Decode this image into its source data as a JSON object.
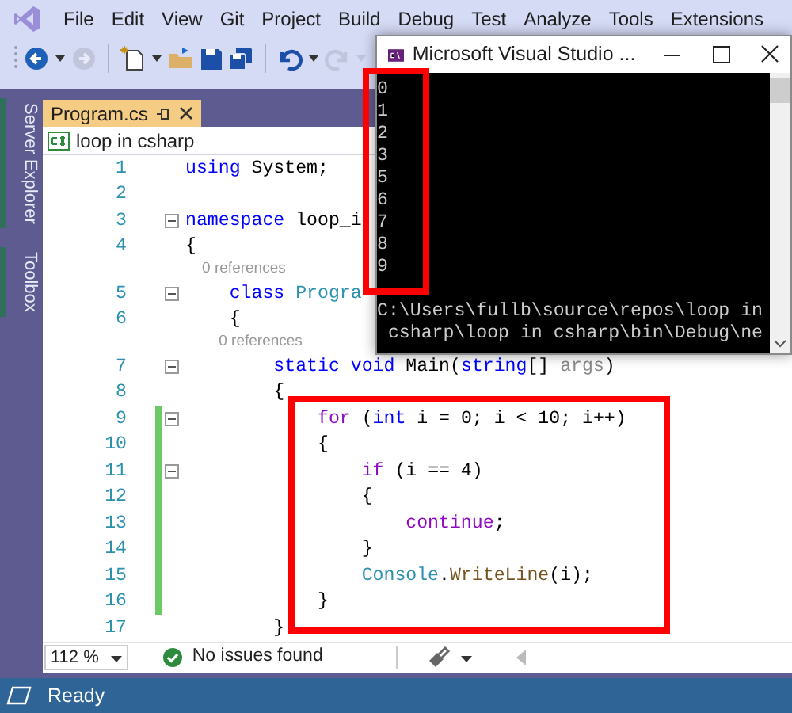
{
  "menu_items": [
    "File",
    "Edit",
    "View",
    "Git",
    "Project",
    "Build",
    "Debug",
    "Test",
    "Analyze",
    "Tools",
    "Extensions"
  ],
  "toolbar": [
    {
      "kind": "back",
      "disabled": false
    },
    {
      "kind": "dropdown",
      "disabled": false
    },
    {
      "kind": "forward",
      "disabled": true
    },
    {
      "kind": "separator"
    },
    {
      "kind": "new-item",
      "disabled": false
    },
    {
      "kind": "dropdown",
      "disabled": false
    },
    {
      "kind": "open",
      "disabled": false
    },
    {
      "kind": "save",
      "disabled": false
    },
    {
      "kind": "save-all",
      "disabled": false
    },
    {
      "kind": "separator"
    },
    {
      "kind": "undo",
      "disabled": false
    },
    {
      "kind": "dropdown",
      "disabled": false
    },
    {
      "kind": "redo",
      "disabled": true
    },
    {
      "kind": "dropdown",
      "disabled": true
    }
  ],
  "side_tabs": [
    {
      "label": "Server Explorer"
    },
    {
      "label": "Toolbox"
    }
  ],
  "document_tabs": [
    {
      "label": "Program.cs",
      "selected": true
    }
  ],
  "navigation_bar": {
    "project": "loop in csharp"
  },
  "code_lines": [
    {
      "kind": "code",
      "number": "1",
      "changed": false,
      "fold": false,
      "tokens": [
        {
          "text": "using",
          "kind": "keyword"
        },
        {
          "text": " System;",
          "kind": "plain"
        }
      ]
    },
    {
      "kind": "code",
      "number": "2",
      "changed": false,
      "fold": false
    },
    {
      "kind": "code",
      "number": "3",
      "changed": false,
      "fold": true,
      "tokens": [
        {
          "text": "namespace",
          "kind": "keyword"
        },
        {
          "text": " loop_i",
          "kind": "plain"
        }
      ]
    },
    {
      "kind": "code",
      "number": "4",
      "changed": false,
      "fold": false,
      "tokens": [
        {
          "text": "{",
          "kind": "plain"
        }
      ]
    },
    {
      "kind": "refs",
      "tokens": [
        {
          "text": "    0 references",
          "kind": "refs"
        }
      ]
    },
    {
      "kind": "code",
      "number": "5",
      "changed": false,
      "fold": true,
      "tokens": [
        {
          "text": "    class",
          "kind": "keyword"
        },
        {
          "text": " Progra",
          "kind": "type"
        }
      ]
    },
    {
      "kind": "code",
      "number": "6",
      "changed": false,
      "fold": false,
      "tokens": [
        {
          "text": "    {",
          "kind": "plain"
        }
      ]
    },
    {
      "kind": "refs",
      "tokens": [
        {
          "text": "        0 references",
          "kind": "refs"
        }
      ]
    },
    {
      "kind": "code",
      "number": "7",
      "changed": false,
      "fold": true,
      "tokens": [
        {
          "text": "        static",
          "kind": "keyword"
        },
        {
          "text": " void",
          "kind": "keyword"
        },
        {
          "text": " Main(",
          "kind": "plain"
        },
        {
          "text": "string",
          "kind": "keyword"
        },
        {
          "text": "[] ",
          "kind": "plain"
        },
        {
          "text": "args",
          "kind": "unused"
        },
        {
          "text": ")",
          "kind": "plain"
        }
      ]
    },
    {
      "kind": "code",
      "number": "8",
      "changed": false,
      "fold": false,
      "tokens": [
        {
          "text": "        {",
          "kind": "plain"
        }
      ]
    },
    {
      "kind": "code",
      "number": "9",
      "changed": true,
      "fold": true,
      "tokens": [
        {
          "text": "            for",
          "kind": "control"
        },
        {
          "text": " (",
          "kind": "plain"
        },
        {
          "text": "int",
          "kind": "keyword"
        },
        {
          "text": " i = 0; i < 10; i++)",
          "kind": "plain"
        }
      ]
    },
    {
      "kind": "code",
      "number": "10",
      "changed": true,
      "fold": false,
      "tokens": [
        {
          "text": "            {",
          "kind": "plain"
        }
      ]
    },
    {
      "kind": "code",
      "number": "11",
      "changed": true,
      "fold": true,
      "tokens": [
        {
          "text": "                if",
          "kind": "control"
        },
        {
          "text": " (i == 4)",
          "kind": "plain"
        }
      ]
    },
    {
      "kind": "code",
      "number": "12",
      "changed": true,
      "fold": false,
      "tokens": [
        {
          "text": "                {",
          "kind": "plain"
        }
      ]
    },
    {
      "kind": "code",
      "number": "13",
      "changed": true,
      "fold": false,
      "tokens": [
        {
          "text": "                    continue",
          "kind": "control"
        },
        {
          "text": ";",
          "kind": "plain"
        }
      ]
    },
    {
      "kind": "code",
      "number": "14",
      "changed": true,
      "fold": false,
      "tokens": [
        {
          "text": "                }",
          "kind": "plain"
        }
      ]
    },
    {
      "kind": "code",
      "number": "15",
      "changed": true,
      "fold": false,
      "tokens": [
        {
          "text": "                Console",
          "kind": "type"
        },
        {
          "text": ".",
          "kind": "plain"
        },
        {
          "text": "WriteLine",
          "kind": "method"
        },
        {
          "text": "(i);",
          "kind": "plain"
        }
      ]
    },
    {
      "kind": "code",
      "number": "16",
      "changed": true,
      "fold": false,
      "tokens": [
        {
          "text": "            }",
          "kind": "plain"
        }
      ]
    },
    {
      "kind": "code",
      "number": "17",
      "changed": false,
      "fold": false,
      "tokens": [
        {
          "text": "        }",
          "kind": "plain"
        }
      ]
    }
  ],
  "editor_status": {
    "zoom": "112 %",
    "issues": "No issues found"
  },
  "console": {
    "title": "Microsoft Visual Studio ...",
    "output": [
      "0",
      "1",
      "2",
      "3",
      "5",
      "6",
      "7",
      "8",
      "9"
    ],
    "path_lines": [
      "C:\\Users\\fullb\\source\\repos\\loop in",
      " csharp\\loop in csharp\\bin\\Debug\\ne"
    ]
  },
  "status_bar": {
    "text": "Ready"
  }
}
